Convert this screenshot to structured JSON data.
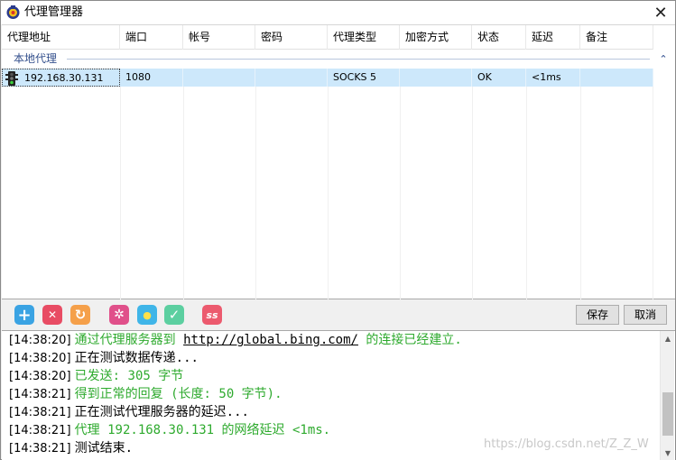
{
  "window": {
    "title": "代理管理器",
    "close_symbol": "✕"
  },
  "grid": {
    "columns": [
      "代理地址",
      "端口",
      "帐号",
      "密码",
      "代理类型",
      "加密方式",
      "状态",
      "延迟",
      "备注"
    ],
    "group_label": "本地代理",
    "collapse_symbol": "⌃",
    "rows": [
      {
        "address": "192.168.30.131",
        "port": "1080",
        "account": "",
        "password": "",
        "type": "SOCKS 5",
        "encryption": "",
        "status": "OK",
        "latency": "<1ms",
        "note": ""
      }
    ]
  },
  "toolbar": {
    "save_label": "保存",
    "cancel_label": "取消",
    "icons": [
      {
        "name": "add-icon",
        "glyph": "+",
        "color": "#3aa3e3"
      },
      {
        "name": "delete-icon",
        "glyph": "✕",
        "color": "#e84c64"
      },
      {
        "name": "refresh-icon",
        "glyph": "↻",
        "color": "#f5a04a"
      },
      {
        "name": "settings-icon",
        "glyph": "✲",
        "color": "#e0508a"
      },
      {
        "name": "tip-icon",
        "glyph": "●",
        "color": "#3fb5e8"
      },
      {
        "name": "check-icon",
        "glyph": "✓",
        "color": "#5ccfa0"
      },
      {
        "name": "shadowsocks-icon",
        "glyph": "ss",
        "color": "#ec5a6e"
      }
    ]
  },
  "log": {
    "lines": [
      {
        "time": "[14:38:20]",
        "parts": [
          {
            "text": "通过代理服务器到 ",
            "style": "green"
          },
          {
            "text": "http://global.bing.com/",
            "style": "link"
          },
          {
            "text": " 的连接已经建立.",
            "style": "green"
          }
        ]
      },
      {
        "time": "[14:38:20]",
        "parts": [
          {
            "text": "正在测试数据传递...",
            "style": "black"
          }
        ]
      },
      {
        "time": "[14:38:20]",
        "parts": [
          {
            "text": "已发送: 305 字节",
            "style": "green"
          }
        ]
      },
      {
        "time": "[14:38:21]",
        "parts": [
          {
            "text": "得到正常的回复 (长度: 50 字节).",
            "style": "green"
          }
        ]
      },
      {
        "time": "[14:38:21]",
        "parts": [
          {
            "text": "正在测试代理服务器的延迟...",
            "style": "black"
          }
        ]
      },
      {
        "time": "[14:38:21]",
        "parts": [
          {
            "text": "代理 192.168.30.131 的网络延迟 <1ms.",
            "style": "green"
          }
        ]
      },
      {
        "time": "[14:38:21]",
        "parts": [
          {
            "text": "测试结束.",
            "style": "black"
          }
        ]
      }
    ],
    "watermark": "https://blog.csdn.net/Z_Z_W"
  }
}
